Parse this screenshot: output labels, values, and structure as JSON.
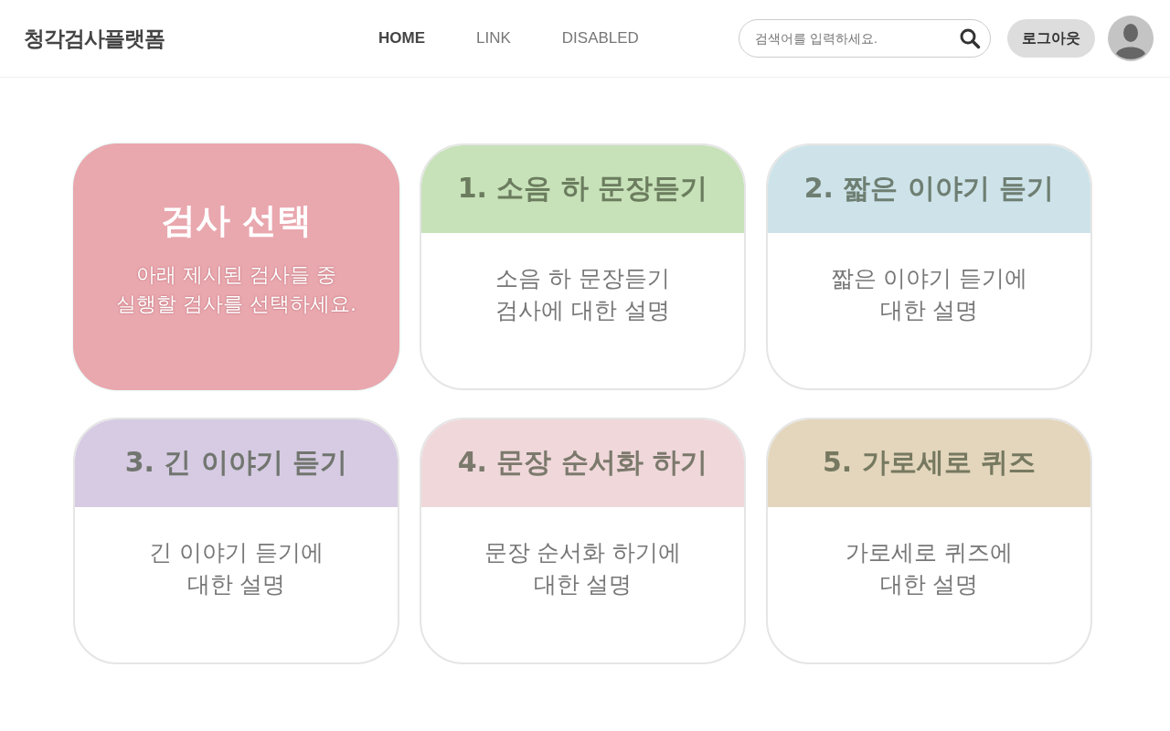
{
  "header": {
    "logo": "청각검사플랫폼",
    "nav": [
      {
        "label": "HOME",
        "selected": true
      },
      {
        "label": "LINK",
        "selected": false
      },
      {
        "label": "DISABLED",
        "selected": false
      }
    ],
    "search": {
      "placeholder": "검색어를 입력하세요."
    },
    "logout": "로그아웃"
  },
  "intro": {
    "title": "검사 선택",
    "lines": [
      "아래 제시된 검사들 중",
      "실행할 검사를 선택하세요."
    ]
  },
  "tests": [
    {
      "title": "1. 소음 하 문장듣기",
      "color": "#c7e1b9",
      "lines": [
        "소음 하 문장듣기",
        "검사에 대한 설명"
      ]
    },
    {
      "title": "2. 짧은 이야기 듣기",
      "color": "#cde3e9",
      "lines": [
        "짧은 이야기 듣기에",
        "대한 설명"
      ]
    },
    {
      "title": "3. 긴 이야기 듣기",
      "color": "#d6cbe3",
      "lines": [
        "긴 이야기 듣기에",
        "대한 설명"
      ]
    },
    {
      "title": "4. 문장 순서화 하기",
      "color": "#efd7da",
      "lines": [
        "문장 순서화 하기에",
        "대한 설명"
      ]
    },
    {
      "title": "5. 가로세로 퀴즈",
      "color": "#e3d6bd",
      "lines": [
        "가로세로 퀴즈에",
        "대한 설명"
      ]
    }
  ]
}
